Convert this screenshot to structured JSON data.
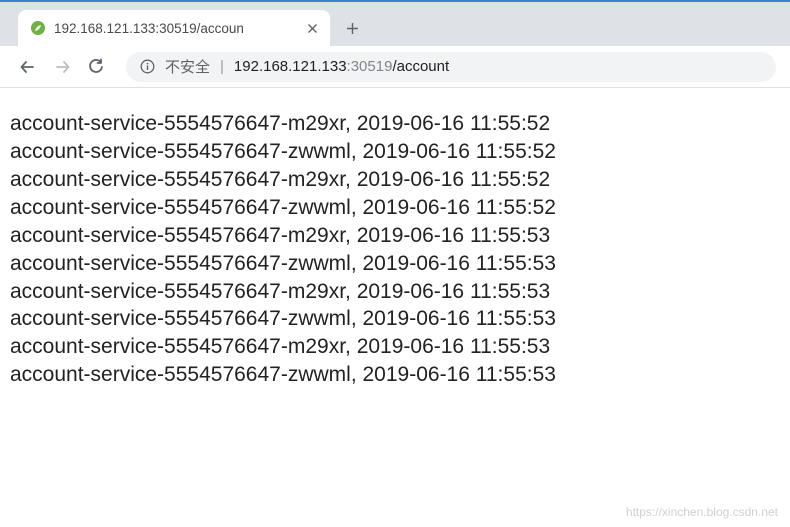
{
  "tab": {
    "title": "192.168.121.133:30519/accoun"
  },
  "address": {
    "unsafe_label": "不安全",
    "host": "192.168.121.133",
    "port": ":30519",
    "path": "/account"
  },
  "content_lines": [
    "account-service-5554576647-m29xr, 2019-06-16 11:55:52",
    "account-service-5554576647-zwwml, 2019-06-16 11:55:52",
    "account-service-5554576647-m29xr, 2019-06-16 11:55:52",
    "account-service-5554576647-zwwml, 2019-06-16 11:55:52",
    "account-service-5554576647-m29xr, 2019-06-16 11:55:53",
    "account-service-5554576647-zwwml, 2019-06-16 11:55:53",
    "account-service-5554576647-m29xr, 2019-06-16 11:55:53",
    "account-service-5554576647-zwwml, 2019-06-16 11:55:53",
    "account-service-5554576647-m29xr, 2019-06-16 11:55:53",
    "account-service-5554576647-zwwml, 2019-06-16 11:55:53"
  ],
  "watermark": "https://xinchen.blog.csdn.net"
}
